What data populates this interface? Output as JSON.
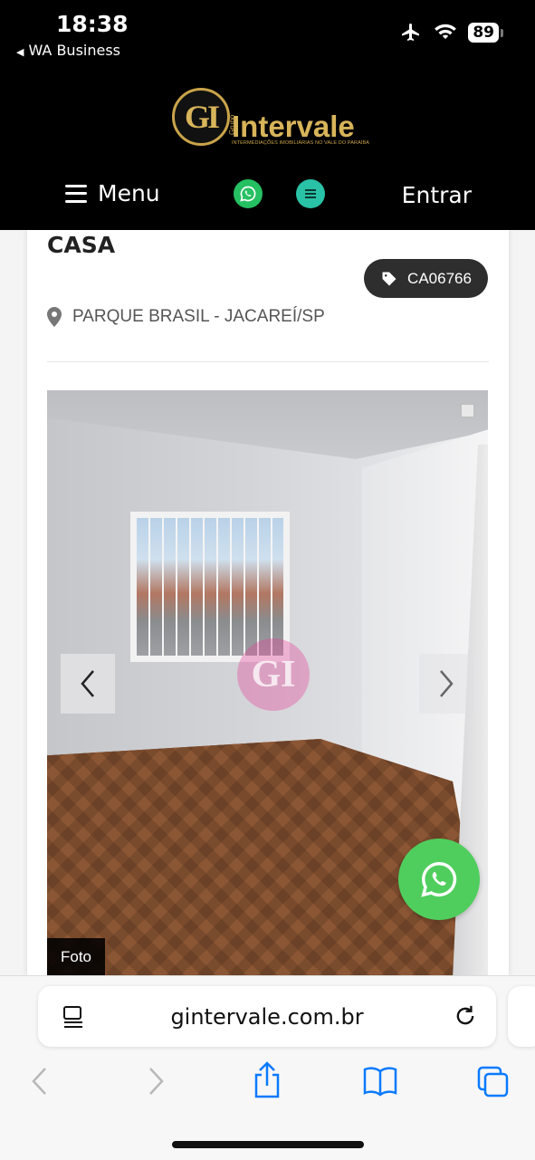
{
  "status_bar": {
    "time": "18:38",
    "back_app": "WA Business",
    "battery": "89",
    "icons": [
      "airplane-icon",
      "wifi-icon",
      "battery-icon"
    ]
  },
  "header": {
    "logo_mark": "GI",
    "logo_grupo": "Grupo",
    "logo_name": "Intervale",
    "logo_tagline": "INTERMEDIAÇÕES IMOBILIÁRIAS NO VALE DO PARAÍBA",
    "menu_label": "Menu",
    "login_label": "Entrar"
  },
  "listing": {
    "type": "CASA",
    "ref_code": "CA06766",
    "location": "PARQUE BRASIL - JACAREÍ/SP",
    "photo_label": "Foto",
    "watermark": "GI"
  },
  "browser": {
    "url": "gintervale.com.br"
  },
  "colors": {
    "header_bg": "#000000",
    "logo_gold": "#d8b45a",
    "whatsapp_green": "#4fce5d",
    "badge_bg": "#2e2e2e",
    "ios_blue": "#0a7aff"
  }
}
